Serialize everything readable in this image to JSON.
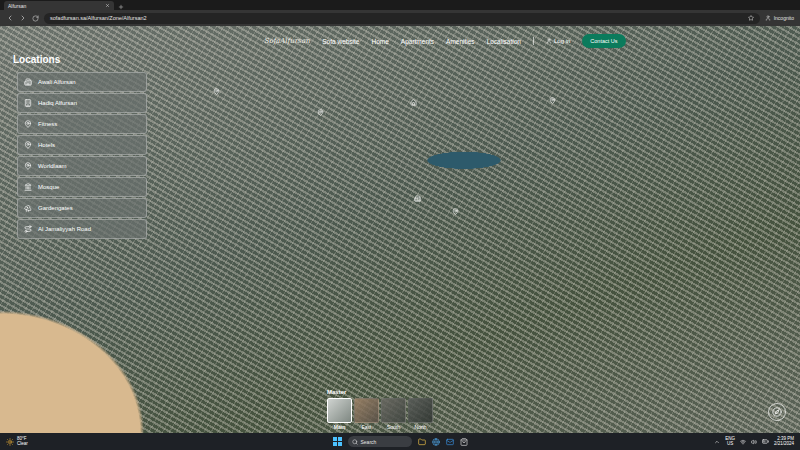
{
  "browser": {
    "tab_title": "Alfursan",
    "url": "sofadfursan.sa/Alfursan/Zone/Alfursan2",
    "profile": "Incognito"
  },
  "nav": {
    "logo": "SofaAlfursan",
    "links": [
      {
        "label": "Sofa website"
      },
      {
        "label": "Home"
      },
      {
        "label": "Apartments"
      },
      {
        "label": "Amenities"
      },
      {
        "label": "Localisation"
      }
    ],
    "login": "Log in",
    "contact": "Contact Us"
  },
  "locations": {
    "title": "Locations",
    "items": [
      {
        "label": "Awali Alfursan",
        "kind": "building"
      },
      {
        "label": "Hadiq Alfursan",
        "kind": "tower"
      },
      {
        "label": "Fitness",
        "kind": "pin"
      },
      {
        "label": "Hotels",
        "kind": "pin"
      },
      {
        "label": "Worldlaam",
        "kind": "pin"
      },
      {
        "label": "Mosque",
        "kind": "mosque"
      },
      {
        "label": "Gardengates",
        "kind": "trees"
      },
      {
        "label": "Al Jamaliyyah Road",
        "kind": "road"
      }
    ]
  },
  "views": {
    "title": "Master",
    "items": [
      {
        "label": "Main",
        "selected": true
      },
      {
        "label": "East",
        "selected": false
      },
      {
        "label": "South",
        "selected": false
      },
      {
        "label": "North",
        "selected": false
      }
    ]
  },
  "taskbar": {
    "weather_temp": "80°F",
    "weather_text": "Clear",
    "search": "Search",
    "lang": "ENG",
    "region": "US",
    "time": "2:39 PM",
    "date": "2/21/2024"
  }
}
